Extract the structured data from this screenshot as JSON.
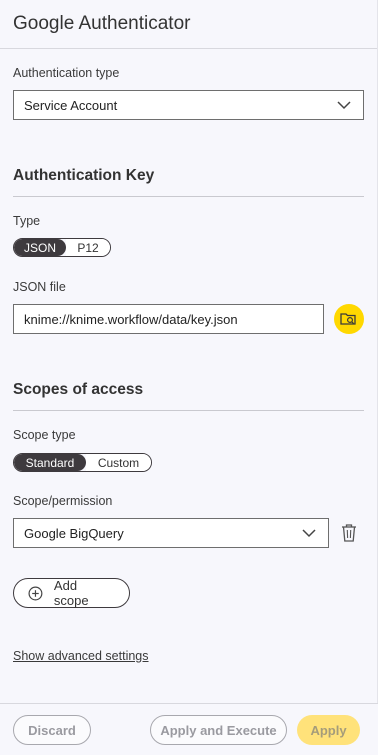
{
  "header": {
    "title": "Google Authenticator"
  },
  "auth_type": {
    "label": "Authentication type",
    "value": "Service Account"
  },
  "auth_key": {
    "title": "Authentication Key",
    "type_label": "Type",
    "type_options": [
      "JSON",
      "P12"
    ],
    "type_selected": "JSON",
    "file_label": "JSON file",
    "file_value": "knime://knime.workflow/data/key.json"
  },
  "scopes": {
    "title": "Scopes of access",
    "scope_type_label": "Scope type",
    "scope_type_options": [
      "Standard",
      "Custom"
    ],
    "scope_type_selected": "Standard",
    "permission_label": "Scope/permission",
    "permission_value": "Google BigQuery",
    "add_scope_label": "Add scope"
  },
  "advanced": {
    "link": "Show advanced settings"
  },
  "footer": {
    "discard": "Discard",
    "apply_execute": "Apply and Execute",
    "apply": "Apply"
  },
  "colors": {
    "accent": "#ffd800",
    "toggle_active": "#3e3a3e"
  },
  "icons": [
    "chevron-down-icon",
    "folder-search-icon",
    "trash-icon",
    "plus-circle-icon"
  ]
}
